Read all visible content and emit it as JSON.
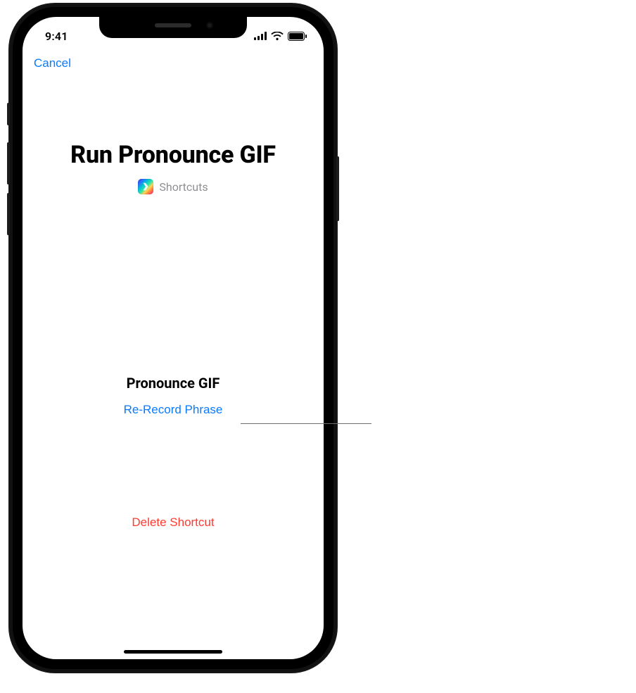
{
  "status": {
    "time": "9:41"
  },
  "nav": {
    "cancel": "Cancel"
  },
  "header": {
    "title": "Run Pronounce GIF",
    "app_label": "Shortcuts"
  },
  "phrase": {
    "title": "Pronounce GIF",
    "rerecord": "Re-Record Phrase"
  },
  "actions": {
    "delete": "Delete Shortcut"
  }
}
